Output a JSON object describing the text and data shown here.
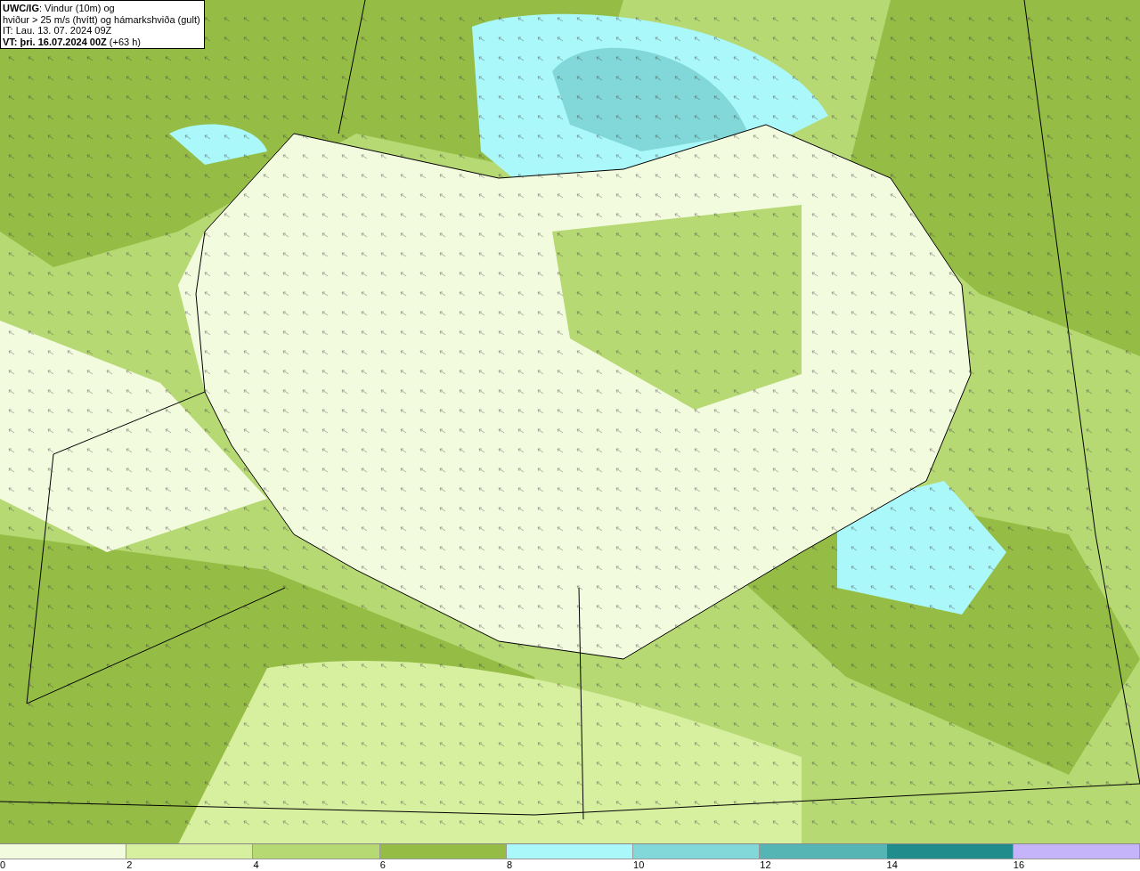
{
  "title_box": {
    "lines": [
      "**UWC/IG**: Vindur (10m) og",
      "hviður > 25 m/s (hvítt) og hámarkshviða (gult)",
      "IT: Lau. 13. 07. 2024 09Z",
      "**VT: þri. 16.07.2024 00Z** (+63 h)"
    ]
  },
  "legend": {
    "bins": [
      {
        "label": "0",
        "color": "#f3fbde"
      },
      {
        "label": "2",
        "color": "#d7f0a0"
      },
      {
        "label": "4",
        "color": "#b6d973"
      },
      {
        "label": "6",
        "color": "#95bd45"
      },
      {
        "label": "8",
        "color": "#aaf8fa"
      },
      {
        "label": "10",
        "color": "#82d8d8"
      },
      {
        "label": "12",
        "color": "#55b4b4"
      },
      {
        "label": "14",
        "color": "#218c8c"
      },
      {
        "label": "16",
        "color": "#c6b4fa"
      }
    ]
  }
}
